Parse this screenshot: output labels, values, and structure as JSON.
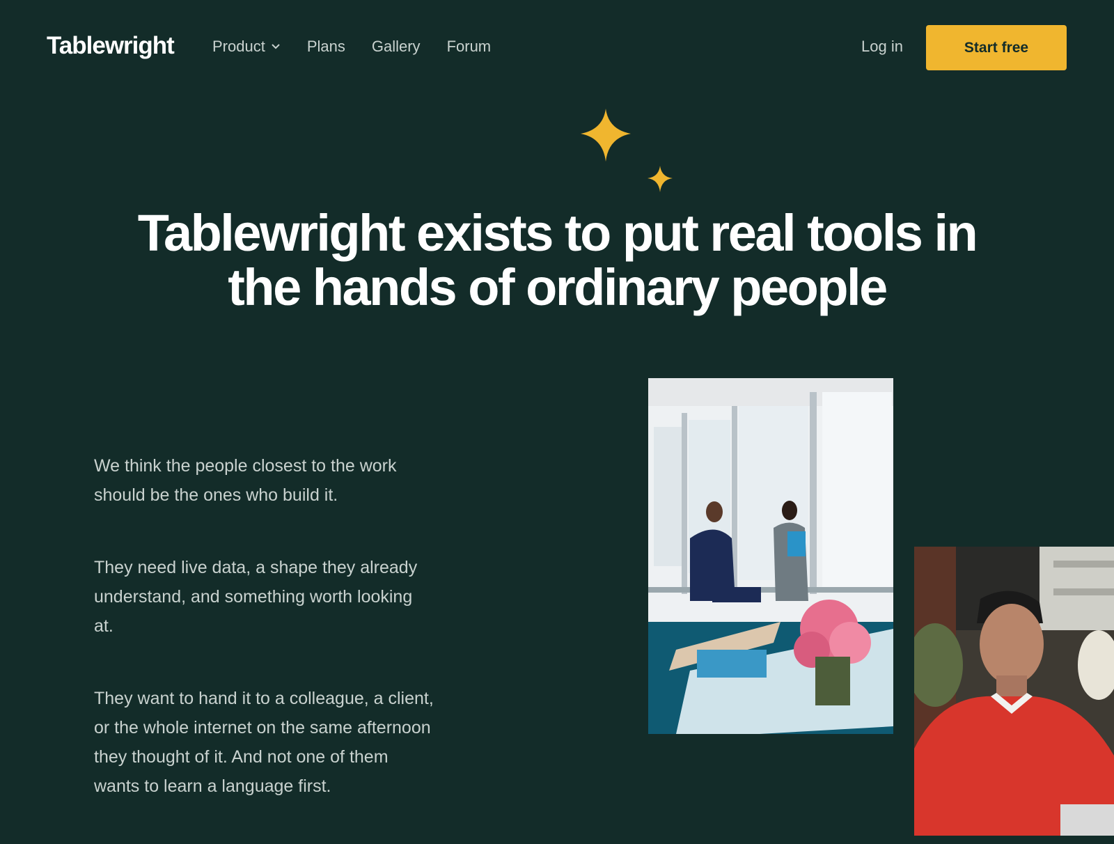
{
  "nav": {
    "logo": "Tablewright",
    "links": [
      {
        "label": "Product",
        "has_dropdown": true
      },
      {
        "label": "Plans"
      },
      {
        "label": "Gallery"
      },
      {
        "label": "Forum"
      }
    ],
    "login_label": "Log in",
    "cta_label": "Start free"
  },
  "hero": {
    "headline": "Tablewright exists to put real tools in the hands of ordinary people"
  },
  "copy": {
    "paragraphs": [
      "We think the people closest to the work should be the ones who build it.",
      "They need live data, a shape they already understand, and something worth looking at.",
      "They want to hand it to a colleague, a client, or the whole internet on the same afternoon they thought of it. And not one of them wants to learn a language first."
    ]
  },
  "colors": {
    "background": "#132c29",
    "accent": "#f0b62f",
    "muted_text": "#c9d2cf"
  },
  "icons": [
    "chevron-down-icon",
    "sparkle-icon"
  ]
}
